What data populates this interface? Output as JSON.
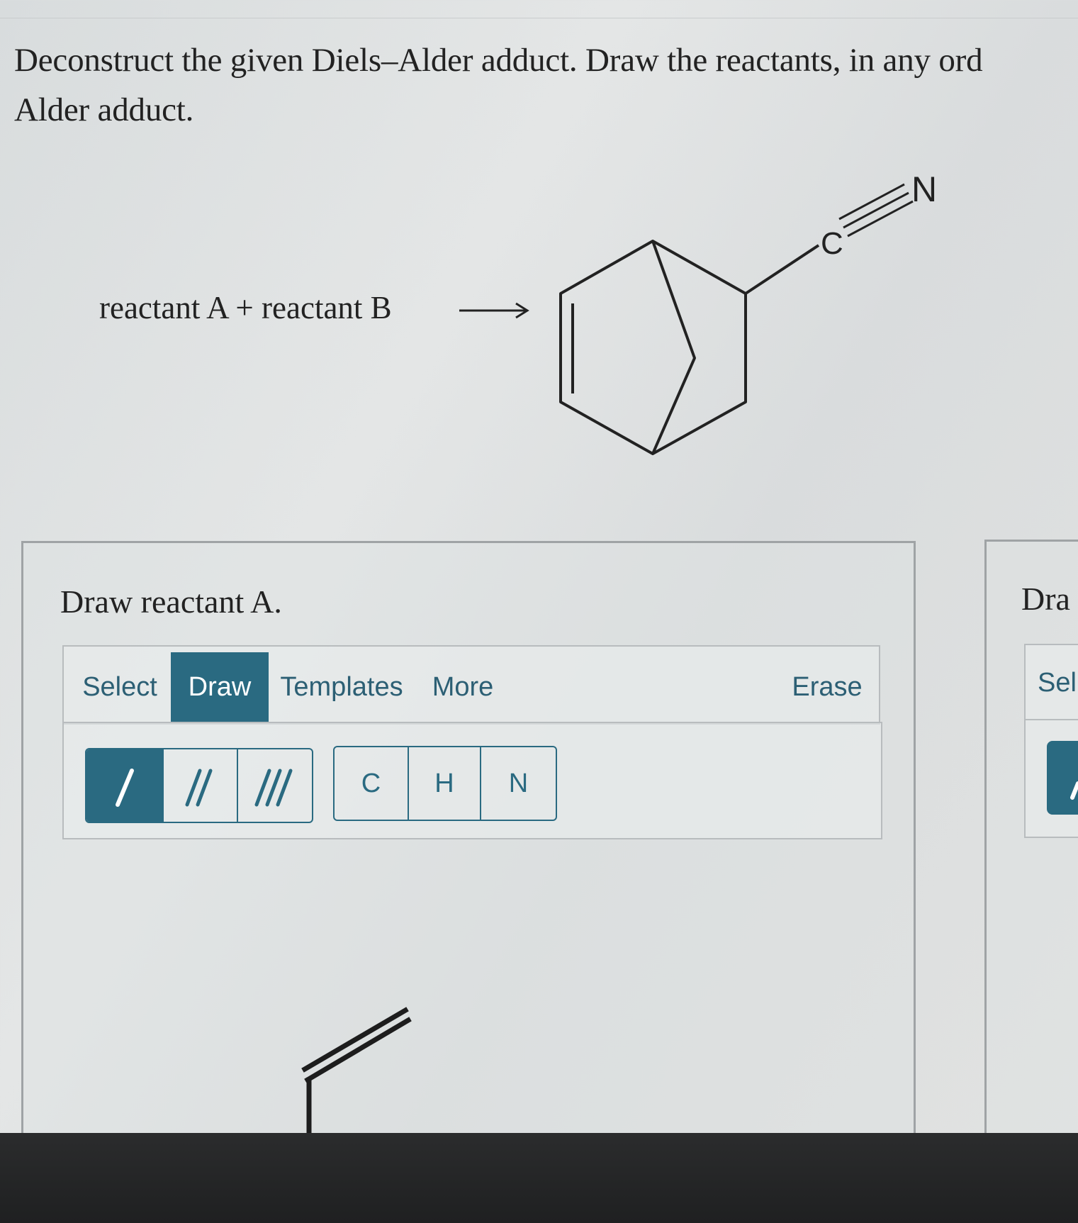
{
  "question": {
    "line1": "Deconstruct the given Diels–Alder adduct. Draw the reactants, in any ord",
    "line2": "Alder adduct."
  },
  "reaction": {
    "text": "reactant A + reactant B",
    "arrow": "⟶",
    "atom_c": "C",
    "atom_n": "N"
  },
  "panel_a": {
    "title": "Draw reactant A.",
    "tabs": [
      "Select",
      "Draw",
      "Templates",
      "More"
    ],
    "active_tab": "Draw",
    "erase": "Erase",
    "bond_tools": [
      "single-bond",
      "double-bond",
      "triple-bond"
    ],
    "atoms": [
      "C",
      "H",
      "N"
    ]
  },
  "panel_b": {
    "title_fragment": "Dra",
    "tab_fragment": "Sel"
  },
  "colors": {
    "accent": "#2a6a81",
    "page_bg": "#dfe2e3",
    "panel_border": "#9fa3a5",
    "text": "#222222",
    "bottom_bar": "#252627"
  }
}
